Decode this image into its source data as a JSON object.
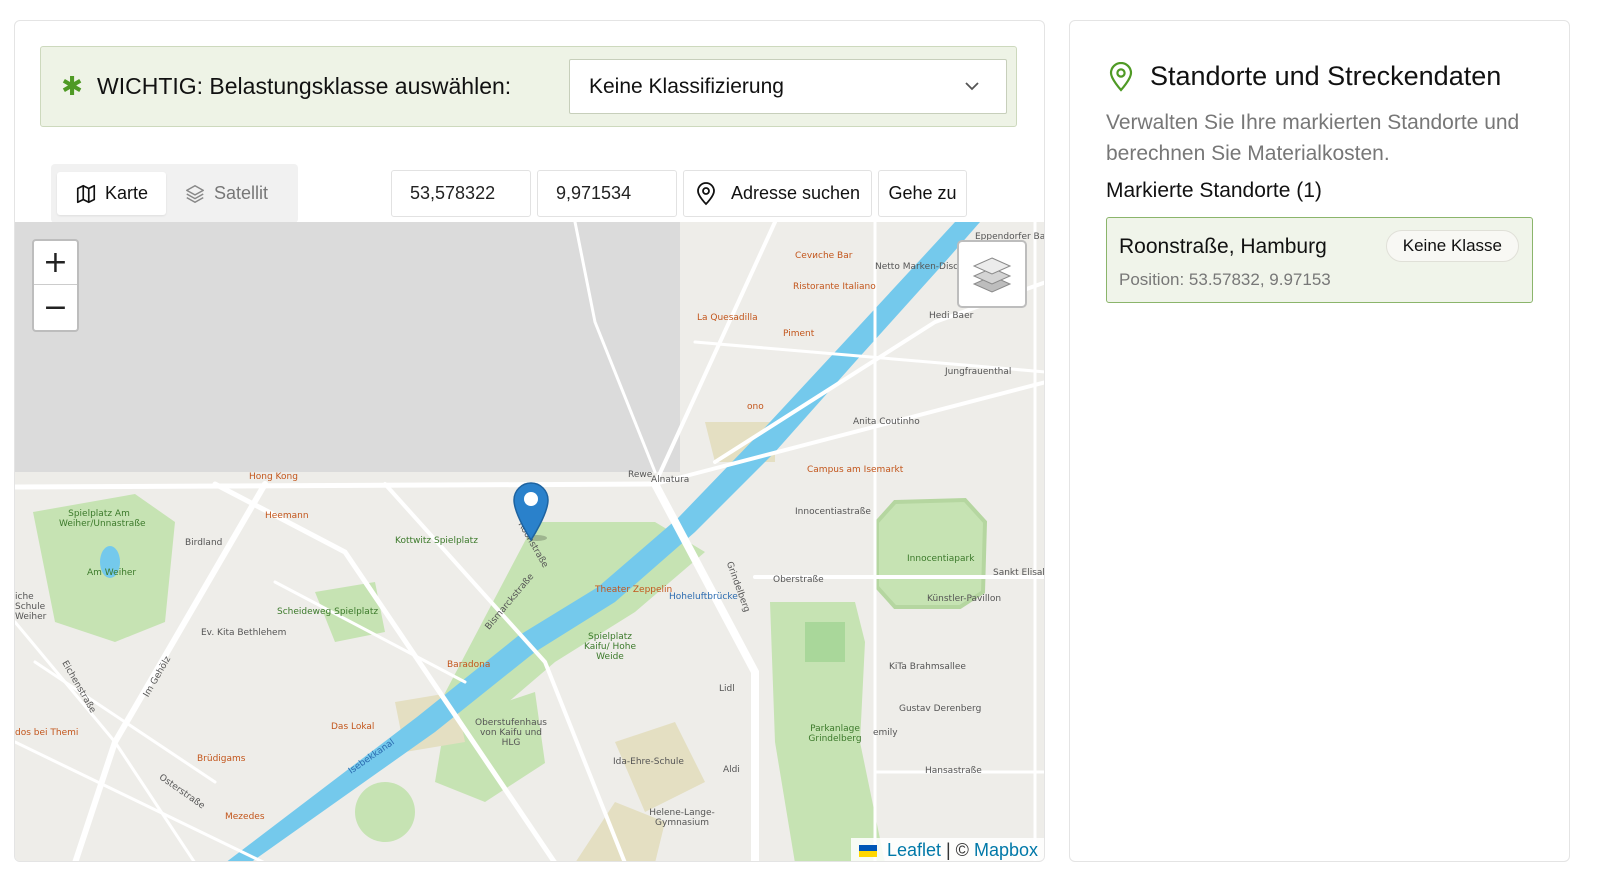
{
  "class_select": {
    "label": "WICHTIG: Belastungsklasse auswählen:",
    "selected": "Keine Klassifizierung",
    "required_icon": "asterisk-icon",
    "accent_color": "#4f9a25"
  },
  "map_toolbar": {
    "tabs": [
      {
        "label": "Karte",
        "icon": "map-icon",
        "active": true
      },
      {
        "label": "Satellit",
        "icon": "layers-icon",
        "active": false
      }
    ],
    "latitude": "53,578322",
    "longitude": "9,971534",
    "address_search_label": "Adresse suchen",
    "goto_label": "Gehe zu"
  },
  "map": {
    "zoom_in": "+",
    "zoom_out": "−",
    "attribution": {
      "leaflet": "Leaflet",
      "separator": "| ©",
      "mapbox": "Mapbox"
    },
    "labels": {
      "l1": "Cevиche Bar",
      "l2": "Netto Marken-Discount",
      "l3": "Ristorante Italiano",
      "l4": "La Quesadilla",
      "l5": "Piment",
      "l6": "Hedi Baer",
      "l7": "Jungfrauenthal",
      "l8": "ono",
      "l9": "Anita Coutinho",
      "l10": "Campus am Isemarkt",
      "l11": "Hong Kong",
      "l12": "Rewe",
      "l13": "Alnatura",
      "l14": "Spielplatz Am Weiher/Unnastraße",
      "l15": "Heemann",
      "l16": "Birdland",
      "l17": "Kottwitz Spielplatz",
      "l18": "Am Weiher",
      "l19": "Innocentiastraße",
      "l20": "Innocentiapark",
      "l21": "Sankt Elisabet",
      "l22": "Theater Zeppelin",
      "l23": "Hoheluftbrücke",
      "l24": "Oberstraße",
      "l25": "Künstler-Pavillon",
      "l26": "Scheideweg Spielplatz",
      "l27": "Ev. Kita Bethlehem",
      "l28": "Spielplatz Kaifu/ Hohe Weide",
      "l29": "KiTa Brahmsallee",
      "l30": "Baradona",
      "l31": "Lidl",
      "l32": "Gustav Derenberg",
      "l33": "Das Lokal",
      "l34": "Oberstufenhaus von Kaifu und HLG",
      "l35": "Parkanlage Grindelberg",
      "l36": "emily",
      "l37": "Brüdigams",
      "l38": "Ida-Ehre-Schule",
      "l39": "Aldi",
      "l40": "Hansastraße",
      "l41": "Mezedes",
      "l42": "Helene-Lange-Gymnasium",
      "l43": "dos bei Themi",
      "l44": "Isebekkanal",
      "l45": "Roonstraße",
      "l46": "Bismarckstraße",
      "l47": "Grindelberg",
      "l48": "Eppendorfer Baum",
      "l49": "iche Schule Weiher",
      "l50": "Eichenstraße",
      "l51": "Im Gehölz",
      "l52": "Osterstraße"
    }
  },
  "panel": {
    "title": "Standorte und Streckendaten",
    "description": "Verwalten Sie Ihre markierten Standorte und berechnen Sie Materialkosten.",
    "section_label": "Markierte Standorte (1)",
    "locations": [
      {
        "name": "Roonstraße, Hamburg",
        "position": "Position: 53.57832, 9.97153",
        "badge": "Keine Klasse"
      }
    ]
  }
}
